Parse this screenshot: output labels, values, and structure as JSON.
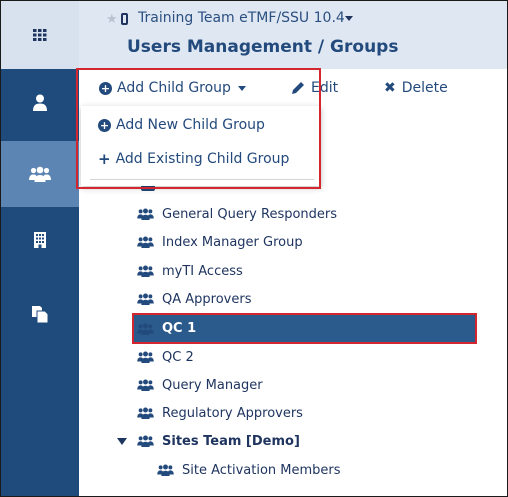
{
  "header": {
    "study_name": "Training Team eTMF/SSU 10.4",
    "page_title": "Users Management / Groups"
  },
  "toolbar": {
    "add_child_label": "Add Child Group",
    "edit_label": "Edit",
    "delete_label": "Delete"
  },
  "dropdown": {
    "items": [
      {
        "label": "Add New Child Group"
      },
      {
        "label": "Add Existing Child Group"
      }
    ]
  },
  "tree": {
    "items": [
      {
        "label": "General Query Responders"
      },
      {
        "label": "Index Manager Group"
      },
      {
        "label": "myTI Access"
      },
      {
        "label": "QA Approvers"
      },
      {
        "label": "QC 1"
      },
      {
        "label": "QC 2"
      },
      {
        "label": "Query Manager"
      },
      {
        "label": "Regulatory Approvers"
      },
      {
        "label": "Sites Team [Demo]"
      },
      {
        "label": "Site Activation Members"
      }
    ]
  },
  "colors": {
    "sidebar": "#1f4a7c",
    "sidebar_active": "#5d85b3",
    "header_bg": "#dfe8f2",
    "accent": "#234a7c",
    "selected_row": "#2b5a8c",
    "highlight_box": "#d4262e"
  }
}
